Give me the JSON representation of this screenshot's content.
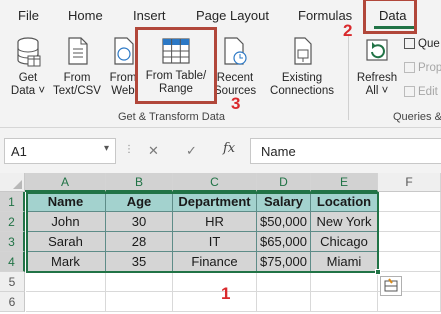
{
  "ribbon_tabs": [
    {
      "label": "File"
    },
    {
      "label": "Home"
    },
    {
      "label": "Insert"
    },
    {
      "label": "Page Layout"
    },
    {
      "label": "Formulas"
    },
    {
      "label": "Data",
      "active": true
    }
  ],
  "ribbon": {
    "get_data": {
      "line1": "Get",
      "line2": "Data ˅"
    },
    "from_text_csv": {
      "line1": "From",
      "line2": "Text/CSV"
    },
    "from_web": {
      "line1": "From",
      "line2": "Web"
    },
    "from_table_range": {
      "line1": "From Table/",
      "line2": "Range"
    },
    "recent_sources": {
      "line1": "Recent",
      "line2": "Sources"
    },
    "existing_connections": {
      "line1": "Existing",
      "line2": "Connections"
    },
    "refresh_all": {
      "line1": "Refresh",
      "line2": "All ˅"
    },
    "queries_item": "Que",
    "properties_item": "Prop",
    "edit_links_item": "Edit",
    "group_get_transform": "Get & Transform Data",
    "group_queries": "Queries &"
  },
  "annotations": {
    "one": "1",
    "two": "2",
    "three": "3"
  },
  "formula_bar": {
    "name_box": "A1",
    "cancel_glyph": "✕",
    "enter_glyph": "✓",
    "fx": "fx",
    "formula": "Name"
  },
  "grid": {
    "columns": [
      "A",
      "B",
      "C",
      "D",
      "E",
      "F"
    ],
    "rows": [
      "1",
      "2",
      "3",
      "4",
      "5",
      "6"
    ],
    "table": {
      "headers": [
        "Name",
        "Age",
        "Department",
        "Salary",
        "Location"
      ],
      "rows": [
        [
          "John",
          "30",
          "HR",
          "$50,000",
          "New York"
        ],
        [
          "Sarah",
          "28",
          "IT",
          "$65,000",
          "Chicago"
        ],
        [
          "Mark",
          "35",
          "Finance",
          "$75,000",
          "Miami"
        ]
      ]
    }
  },
  "colors": {
    "accent": "#217346",
    "table_header_fill": "#a3d2ce",
    "table_data_fill": "#d5d5d5",
    "annotation_red": "#d9292c"
  }
}
